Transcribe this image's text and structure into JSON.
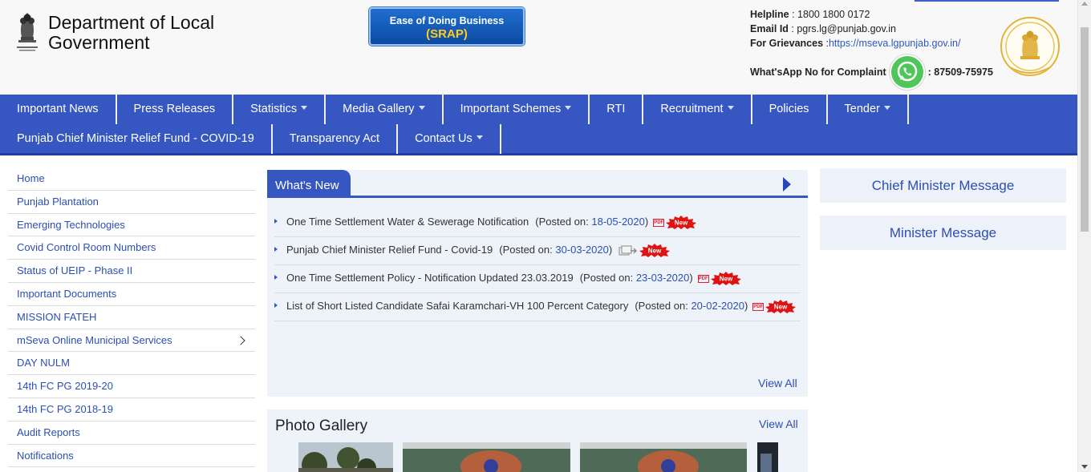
{
  "header": {
    "dept_title_line1": "Department of Local",
    "dept_title_line2": "Government",
    "srap_line1": "Ease of Doing Business",
    "srap_line2": "(SRAP)",
    "helpline_label": "Helpline",
    "helpline_value": " : 1800 1800 0172",
    "email_label": "Email Id",
    "email_value": " : pgrs.lg@punjab.gov.in",
    "grievance_label": "For Grievances",
    "grievance_sep": " :",
    "grievance_link": "https://mseva.lgpunjab.gov.in/",
    "whatsapp_label": "What'sApp No for Complaint",
    "whatsapp_value": ": 87509-75975"
  },
  "nav": {
    "row1": [
      {
        "label": "Important News",
        "caret": false
      },
      {
        "label": "Press Releases",
        "caret": false
      },
      {
        "label": "Statistics",
        "caret": true
      },
      {
        "label": "Media Gallery",
        "caret": true
      },
      {
        "label": "Important Schemes",
        "caret": true
      },
      {
        "label": "RTI",
        "caret": false
      },
      {
        "label": "Recruitment",
        "caret": true
      },
      {
        "label": "Policies",
        "caret": false
      },
      {
        "label": "Tender",
        "caret": true
      }
    ],
    "row2": [
      {
        "label": "Punjab Chief Minister Relief Fund - COVID-19",
        "caret": false
      },
      {
        "label": "Transparency Act",
        "caret": false
      },
      {
        "label": "Contact Us",
        "caret": true
      }
    ]
  },
  "sidebar": {
    "items": [
      "Home",
      "Punjab Plantation",
      "Emerging Technologies",
      "Covid Control Room Numbers",
      "Status of UEIP - Phase II",
      "Important Documents",
      "MISSION FATEH",
      "mSeva Online Municipal Services",
      "DAY NULM",
      "14th FC PG 2019-20",
      "14th FC PG 2018-19",
      "Audit Reports",
      "Notifications"
    ]
  },
  "whats_new": {
    "title": "What's New",
    "posted_prefix": "(Posted on: ",
    "posted_suffix": ")",
    "new_label": "New",
    "pdf_label": "PDF",
    "items": [
      {
        "title": "One Time Settlement Water & Sewerage Notification",
        "date": "18-05-2020",
        "icon": "pdf-icon"
      },
      {
        "title": "Punjab Chief Minister Relief Fund - Covid-19",
        "date": "30-03-2020",
        "icon": "share-link-icon"
      },
      {
        "title": "One Time Settlement Policy - Notification Updated 23.03.2019",
        "date": "23-03-2020",
        "icon": "pdf-icon"
      },
      {
        "title": "List of Short Listed Candidate Safai Karamchari-VH 100 Percent Category",
        "date": "20-02-2020",
        "icon": "pdf-icon"
      }
    ],
    "view_all": "View All"
  },
  "gallery": {
    "title": "Photo Gallery",
    "view_all": "View All"
  },
  "messages": {
    "chief_minister": "Chief Minister Message",
    "minister": "Minister Message"
  },
  "colors": {
    "nav_bg": "#3657c2",
    "link": "#2b4fb4",
    "panel_bg": "#eef3fa"
  }
}
